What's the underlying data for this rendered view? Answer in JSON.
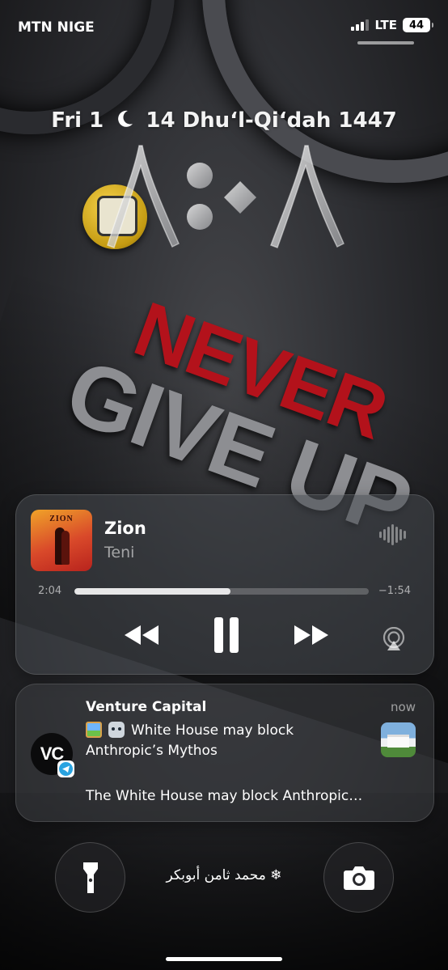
{
  "status_bar": {
    "carrier": "MTN NIGE",
    "network": "LTE",
    "battery": "44",
    "signal_bars": 3
  },
  "lock_screen": {
    "date_prefix": "Fri 1",
    "hijri_date": "14 Dhuʻl-Qiʻdah 1447",
    "moon_icon": "crescent-moon-icon",
    "clock_label": "٨:٨"
  },
  "now_playing": {
    "album_art_text": "ZION",
    "title": "Zion",
    "artist": "Teni",
    "elapsed": "2:04",
    "remaining": "−1:54",
    "progress": 0.53,
    "icons": [
      "waveform-icon",
      "rewind-icon",
      "pause-icon",
      "fast-forward-icon",
      "airplay-icon"
    ]
  },
  "notification": {
    "app_icon_text": "VC",
    "badge_icon": "telegram-icon",
    "sender": "Venture Capital",
    "time": "now",
    "line1": "White House may block",
    "line2": "Anthropic’s Mythos",
    "line3": "The White House may block Anthropic…"
  },
  "bottom": {
    "owner_text": "❄ محمد ثامن أبوبكر",
    "left_button_icon": "flashlight-icon",
    "right_button_icon": "camera-icon"
  },
  "wallpaper": {
    "word1": "NEVER",
    "word2": "GIVE UP",
    "accent_red": "#b3121b",
    "accent_gray": "#8d8e92"
  }
}
